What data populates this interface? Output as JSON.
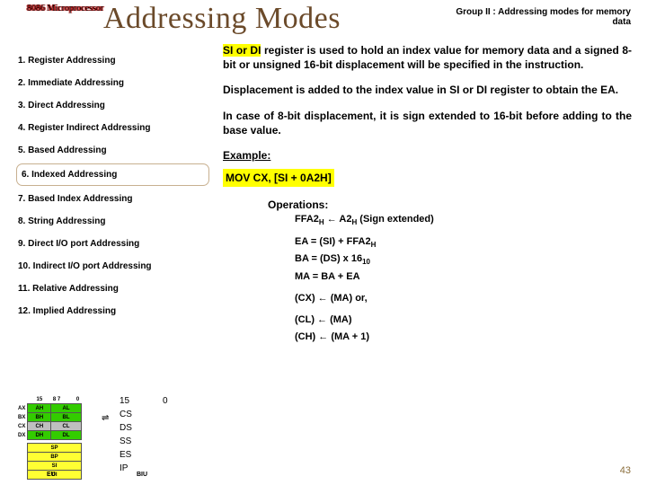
{
  "corner": "8086 Microprocessor",
  "title": "Addressing Modes",
  "group": "Group II : Addressing modes for memory data",
  "list": [
    "1.  Register Addressing",
    "2.  Immediate Addressing",
    "3.  Direct Addressing",
    "4.  Register Indirect Addressing",
    "5.  Based Addressing",
    "6.  Indexed Addressing",
    "7.  Based Index Addressing",
    "8.  String Addressing",
    "9.  Direct I/O port Addressing",
    "10. Indirect I/O port Addressing",
    "11. Relative Addressing",
    "12. Implied Addressing"
  ],
  "highlight_index": 5,
  "para1_pre": "",
  "para1_hl": "SI or DI",
  "para1_post": " register is used to hold an index value for memory data and a signed 8-bit or unsigned 16-bit displacement will be specified in the instruction.",
  "para2": "Displacement is added to the index value in SI or DI register to obtain the EA.",
  "para3": "In case of 8-bit displacement, it is sign extended to 16-bit before adding to the base value.",
  "example_label": "Example:",
  "mov": "MOV CX, [SI + 0A2H]",
  "operations_label": "Operations:",
  "ops": {
    "line1_a": "FFA2",
    "line1_sub1": "H",
    "line1_mid": " ← A2",
    "line1_sub2": "H",
    "line1_end": " (Sign extended)",
    "ea_a": "EA = (SI) + FFA2",
    "ea_sub": "H",
    "ba_a": "BA = (DS) x 16",
    "ba_sub": "10",
    "ma": "MA = BA + EA",
    "cx": "(CX) ← (MA)   or,",
    "cl": "(CL) ← (MA)",
    "ch": "(CH) ← (MA + 1)"
  },
  "eu_label": "EU",
  "biu_label": "BIU",
  "pagenum": "43",
  "regs_left": [
    [
      "AX",
      "AH",
      "AL",
      "green"
    ],
    [
      "BX",
      "BH",
      "BL",
      "green"
    ],
    [
      "CX",
      "CH",
      "CL",
      "grey"
    ],
    [
      "DX",
      "DH",
      "DL",
      "green"
    ]
  ],
  "regs_left2": [
    [
      "SP",
      "yellow"
    ],
    [
      "BP",
      "yellow"
    ],
    [
      "SI",
      "yellow"
    ],
    [
      "DI",
      "yellow"
    ]
  ],
  "regs_right": [
    [
      "CS",
      "red"
    ],
    [
      "DS",
      "orange"
    ],
    [
      "SS",
      "orange"
    ],
    [
      "ES",
      "orange"
    ],
    [
      "IP",
      "cyan"
    ]
  ]
}
